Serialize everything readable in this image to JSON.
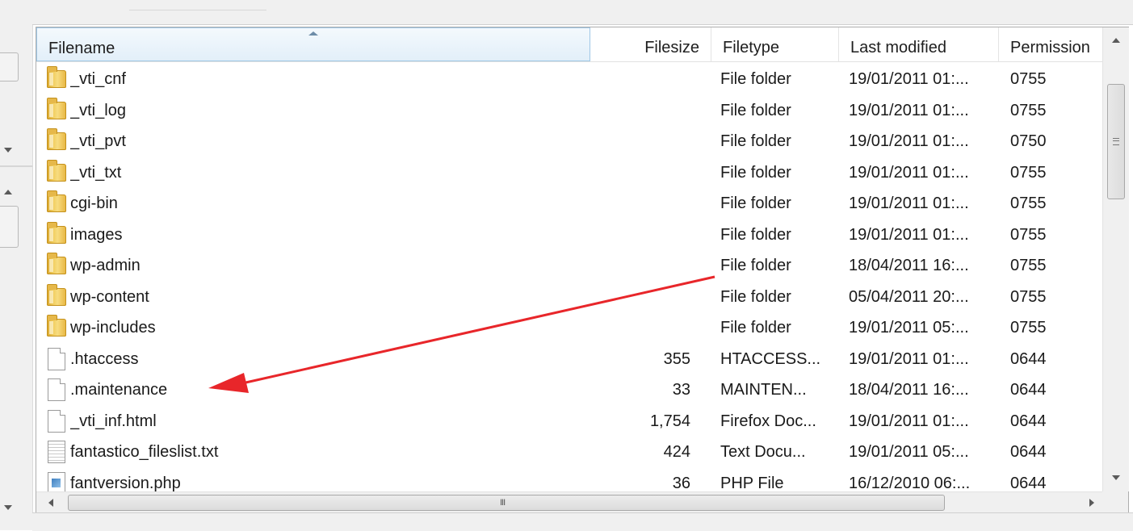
{
  "header": {
    "filename": "Filename",
    "filesize": "Filesize",
    "filetype": "Filetype",
    "last_modified": "Last modified",
    "permissions": "Permission"
  },
  "files": [
    {
      "name": "_vti_cnf",
      "size": "",
      "type": "File folder",
      "modified": "19/01/2011 01:...",
      "perm": "0755",
      "icon": "folder-icon"
    },
    {
      "name": "_vti_log",
      "size": "",
      "type": "File folder",
      "modified": "19/01/2011 01:...",
      "perm": "0755",
      "icon": "folder-icon"
    },
    {
      "name": "_vti_pvt",
      "size": "",
      "type": "File folder",
      "modified": "19/01/2011 01:...",
      "perm": "0750",
      "icon": "folder-icon"
    },
    {
      "name": "_vti_txt",
      "size": "",
      "type": "File folder",
      "modified": "19/01/2011 01:...",
      "perm": "0755",
      "icon": "folder-icon"
    },
    {
      "name": "cgi-bin",
      "size": "",
      "type": "File folder",
      "modified": "19/01/2011 01:...",
      "perm": "0755",
      "icon": "folder-icon"
    },
    {
      "name": "images",
      "size": "",
      "type": "File folder",
      "modified": "19/01/2011 01:...",
      "perm": "0755",
      "icon": "folder-icon"
    },
    {
      "name": "wp-admin",
      "size": "",
      "type": "File folder",
      "modified": "18/04/2011 16:...",
      "perm": "0755",
      "icon": "folder-icon"
    },
    {
      "name": "wp-content",
      "size": "",
      "type": "File folder",
      "modified": "05/04/2011 20:...",
      "perm": "0755",
      "icon": "folder-icon"
    },
    {
      "name": "wp-includes",
      "size": "",
      "type": "File folder",
      "modified": "19/01/2011 05:...",
      "perm": "0755",
      "icon": "folder-icon"
    },
    {
      "name": ".htaccess",
      "size": "355",
      "type": "HTACCESS...",
      "modified": "19/01/2011 01:...",
      "perm": "0644",
      "icon": "file-icon"
    },
    {
      "name": ".maintenance",
      "size": "33",
      "type": "MAINTEN...",
      "modified": "18/04/2011 16:...",
      "perm": "0644",
      "icon": "file-icon"
    },
    {
      "name": "_vti_inf.html",
      "size": "1,754",
      "type": "Firefox Doc...",
      "modified": "19/01/2011 01:...",
      "perm": "0644",
      "icon": "file-icon"
    },
    {
      "name": "fantastico_fileslist.txt",
      "size": "424",
      "type": "Text Docu...",
      "modified": "19/01/2011 05:...",
      "perm": "0644",
      "icon": "text-file-icon"
    },
    {
      "name": "fantversion.php",
      "size": "36",
      "type": "PHP File",
      "modified": "16/12/2010 06:...",
      "perm": "0644",
      "icon": "php-file-icon"
    }
  ],
  "hscroll": {
    "grip": "III"
  },
  "colors": {
    "annotation_arrow": "#e8262a",
    "header_sorted_border": "#9fc7e6",
    "folder": "#f2cf62"
  }
}
